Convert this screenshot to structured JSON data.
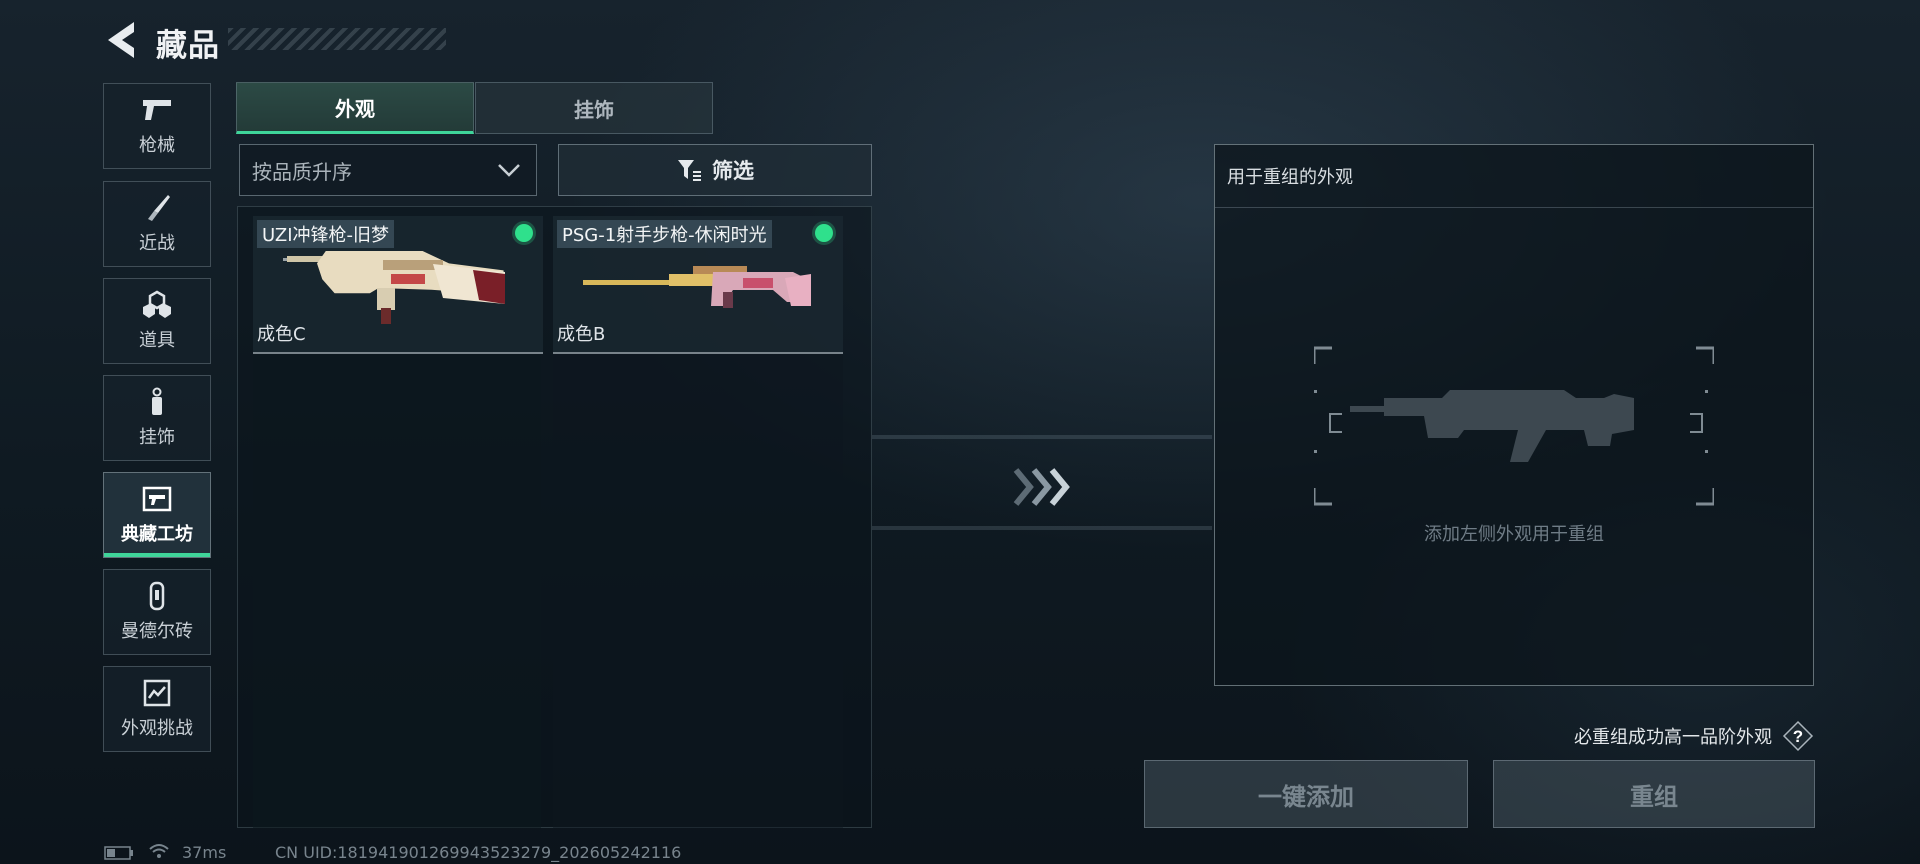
{
  "header": {
    "title": "藏品",
    "back_icon": "back-arrow-icon"
  },
  "sidebar": {
    "items": [
      {
        "label": "枪械",
        "icon": "pistol-icon",
        "active": false
      },
      {
        "label": "近战",
        "icon": "knife-icon",
        "active": false
      },
      {
        "label": "道具",
        "icon": "gear-cubes-icon",
        "active": false
      },
      {
        "label": "挂饰",
        "icon": "charm-icon",
        "active": false
      },
      {
        "label": "典藏工坊",
        "icon": "workshop-icon",
        "active": true
      },
      {
        "label": "曼德尔砖",
        "icon": "brick-icon",
        "active": false
      },
      {
        "label": "外观挑战",
        "icon": "challenge-icon",
        "active": false
      }
    ]
  },
  "tabs": [
    {
      "label": "外观",
      "active": true
    },
    {
      "label": "挂饰",
      "active": false
    }
  ],
  "sort": {
    "value": "按品质升序",
    "icon": "chevron-down-icon"
  },
  "filter": {
    "label": "筛选",
    "icon": "filter-icon"
  },
  "items": [
    {
      "name": "UZI冲锋枪-旧梦",
      "grade": "成色C",
      "status_color": "#2fe08c"
    },
    {
      "name": "PSG-1射手步枪-休闲时光",
      "grade": "成色B",
      "status_color": "#2fe08c"
    }
  ],
  "target": {
    "header": "用于重组的外观",
    "hint": "添加左侧外观用于重组"
  },
  "guarantee": {
    "text": "必重组成功高一品阶外观",
    "icon": "question-icon"
  },
  "buttons": {
    "add_all": "一键添加",
    "recompose": "重组"
  },
  "status_bar": {
    "ping": "37ms",
    "uid": "CN UID:18194190126994352327​9_202605242116"
  },
  "colors": {
    "accent": "#3fd59a",
    "status_green": "#2fe08c"
  }
}
